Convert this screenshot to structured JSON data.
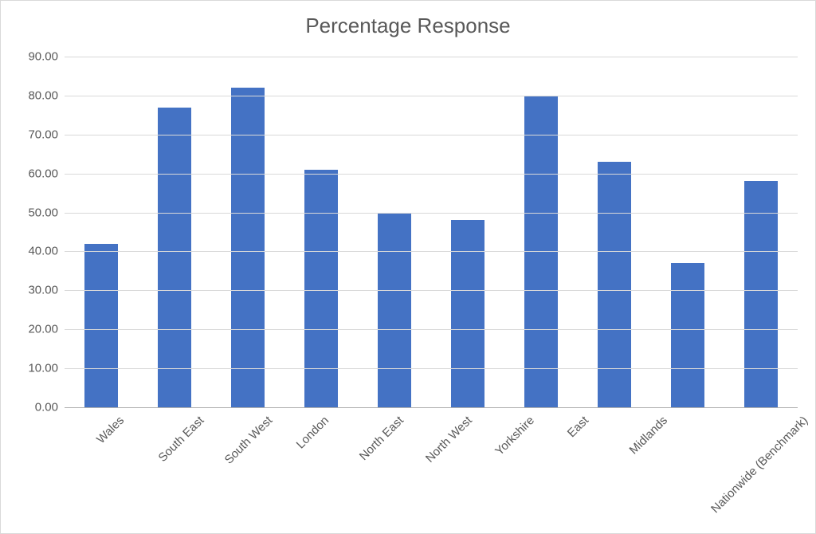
{
  "chart_data": {
    "type": "bar",
    "title": "Percentage Response",
    "xlabel": "",
    "ylabel": "",
    "ylim": [
      0,
      90
    ],
    "ytick_step": 10,
    "categories": [
      "Wales",
      "South East",
      "South West",
      "London",
      "North East",
      "North West",
      "Yorkshire",
      "East",
      "Midlands",
      "Nationwide (Benchmark)"
    ],
    "values": [
      42,
      77,
      82,
      61,
      50,
      48,
      80,
      63,
      37,
      58
    ]
  },
  "colors": {
    "bar_fill": "#4472C4",
    "text": "#595959",
    "grid": "#d9d9d9"
  }
}
